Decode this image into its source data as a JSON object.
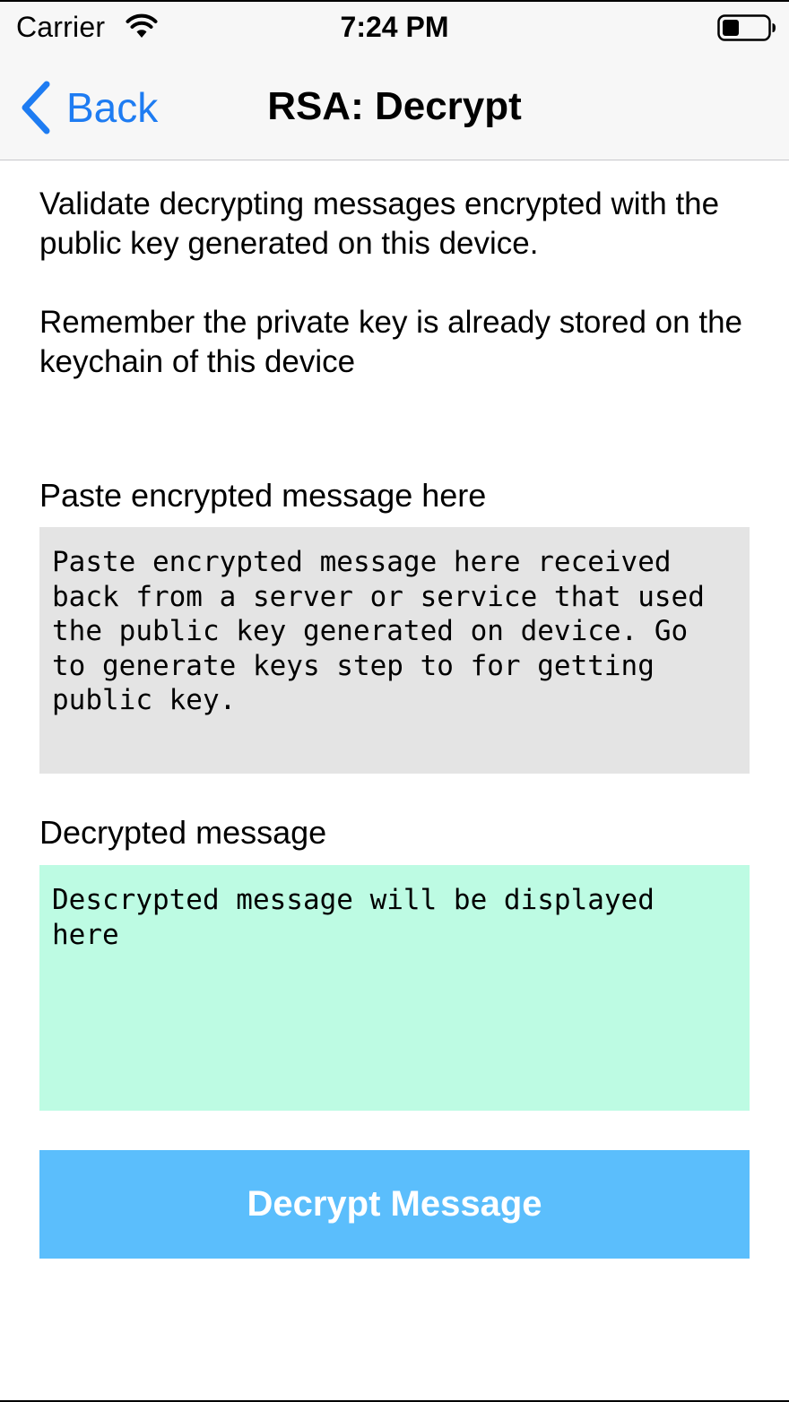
{
  "status_bar": {
    "carrier": "Carrier",
    "time": "7:24 PM",
    "icons": [
      "wifi-icon",
      "battery-icon"
    ]
  },
  "nav": {
    "back_label": "Back",
    "title": "RSA: Decrypt"
  },
  "content": {
    "description_1": "Validate decrypting messages encrypted with the public key generated on this device.",
    "description_2": "Remember the private key is already stored on the keychain of this device"
  },
  "encrypted_section": {
    "label": "Paste encrypted message here",
    "placeholder": "Paste encrypted message here received back from a server or service that used the public key generated on device. Go to generate keys step to for getting public key."
  },
  "decrypted_section": {
    "label": "Decrypted message",
    "value": "Descrypted message will be displayed here"
  },
  "action": {
    "decrypt_label": "Decrypt Message"
  },
  "colors": {
    "accent": "#1e7cf2",
    "encrypted_box_bg": "#e4e4e4",
    "decrypted_box_bg": "#bdfbe3",
    "button_bg": "#5bbefc"
  }
}
